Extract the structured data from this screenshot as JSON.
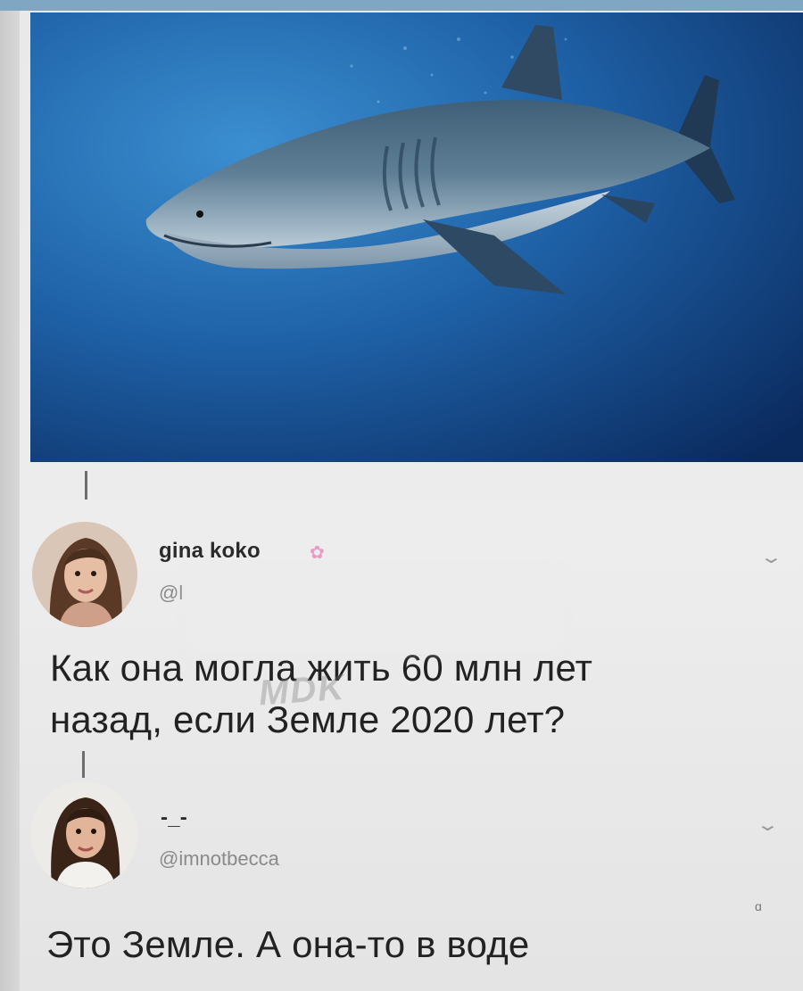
{
  "tweet1": {
    "display_name": "gina koko",
    "name_emoji": "✿",
    "handle": "@l",
    "text_line1": "Как она могла жить 60 млн лет",
    "text_line2": "назад, если Земле 2020 лет?",
    "avatar_icon": "woman-avatar-icon",
    "menu_icon": "chevron-down-icon"
  },
  "tweet2": {
    "display_name": "-_-",
    "handle": "@imnotbecca",
    "text": "Это Земле. А она-то в воде",
    "avatar_icon": "woman-avatar-icon",
    "menu_icon": "chevron-down-icon"
  },
  "watermark": "MDK",
  "colors": {
    "ocean_light": "#2e7fc0",
    "ocean_dark": "#0b2f66",
    "text": "#222222",
    "handle": "#8a8a8a"
  }
}
